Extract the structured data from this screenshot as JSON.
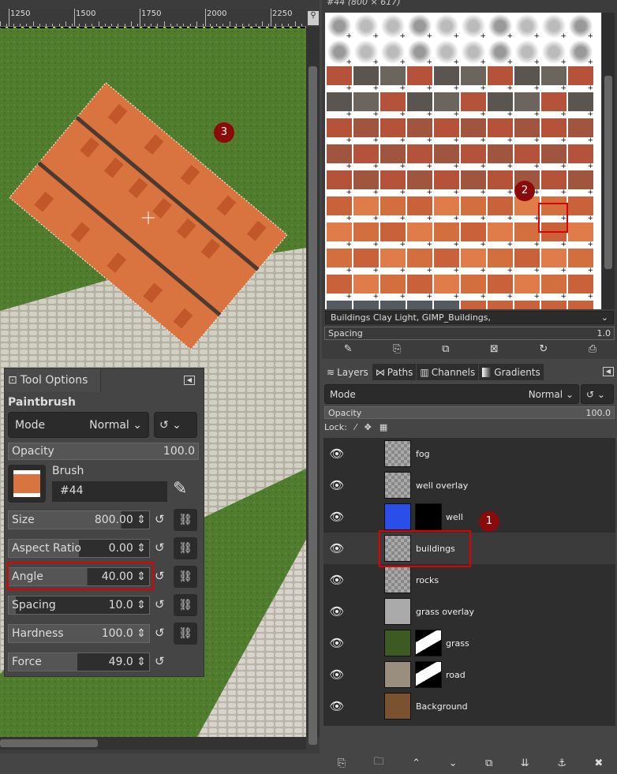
{
  "ruler": {
    "labels": [
      "1250",
      "1500",
      "1750",
      "2000",
      "2250"
    ]
  },
  "brushes": {
    "header": "#44 (800 × 617)",
    "tags": "Buildings Clay Light, GIMP_Buildings,",
    "spacing_label": "Spacing",
    "spacing_value": "1.0",
    "buttons": [
      "edit-brush",
      "new-brush",
      "duplicate-brush",
      "delete-brush",
      "refresh-brushes",
      "open-brush-as-image"
    ]
  },
  "dock_tabs": [
    {
      "label": "Layers",
      "icon": "layers-icon"
    },
    {
      "label": "Paths",
      "icon": "paths-icon"
    },
    {
      "label": "Channels",
      "icon": "channels-icon"
    },
    {
      "label": "Gradients",
      "icon": "gradients-icon"
    }
  ],
  "layers_panel": {
    "mode_label": "Mode",
    "mode_value": "Normal",
    "opacity_label": "Opacity",
    "opacity_value": "100.0",
    "lock_label": "Lock:",
    "layers": [
      {
        "name": "fog",
        "thumb": "transparent"
      },
      {
        "name": "well overlay",
        "thumb": "transparent"
      },
      {
        "name": "well",
        "thumb": "#2b4de8",
        "mask": "#000000"
      },
      {
        "name": "buildings",
        "thumb": "transparent",
        "selected": true
      },
      {
        "name": "rocks",
        "thumb": "transparent"
      },
      {
        "name": "grass overlay",
        "thumb": "#aaaaaa"
      },
      {
        "name": "grass",
        "thumb": "#3c5a22",
        "mask": "bw"
      },
      {
        "name": "road",
        "thumb": "#9a8e7e",
        "mask": "bw"
      },
      {
        "name": "Background",
        "thumb": "#7a5230"
      }
    ],
    "bottom_buttons": [
      "new-layer",
      "new-layer-group",
      "raise-layer",
      "lower-layer",
      "duplicate-layer",
      "merge-down",
      "anchor-layer",
      "delete-layer"
    ]
  },
  "tool_options": {
    "tab_label": "Tool Options",
    "tool_name": "Paintbrush",
    "mode_label": "Mode",
    "mode_value": "Normal",
    "opacity_label": "Opacity",
    "opacity_value": "100.0",
    "brush_label": "Brush",
    "brush_value": "#44",
    "sliders": [
      {
        "label": "Size",
        "value": "800.00",
        "fill": 0.8
      },
      {
        "label": "Aspect Ratio",
        "value": "0.00",
        "fill": 0.5
      },
      {
        "label": "Angle",
        "value": "40.00",
        "fill": 0.56
      },
      {
        "label": "Spacing",
        "value": "10.0",
        "fill": 0.05
      },
      {
        "label": "Hardness",
        "value": "100.0",
        "fill": 1.0
      },
      {
        "label": "Force",
        "value": "49.0",
        "fill": 0.49
      }
    ]
  },
  "annotations": {
    "marker1": "1",
    "marker2": "2",
    "marker3": "3",
    "accent": "#e00000",
    "marker_color": "#8b0a0a"
  }
}
